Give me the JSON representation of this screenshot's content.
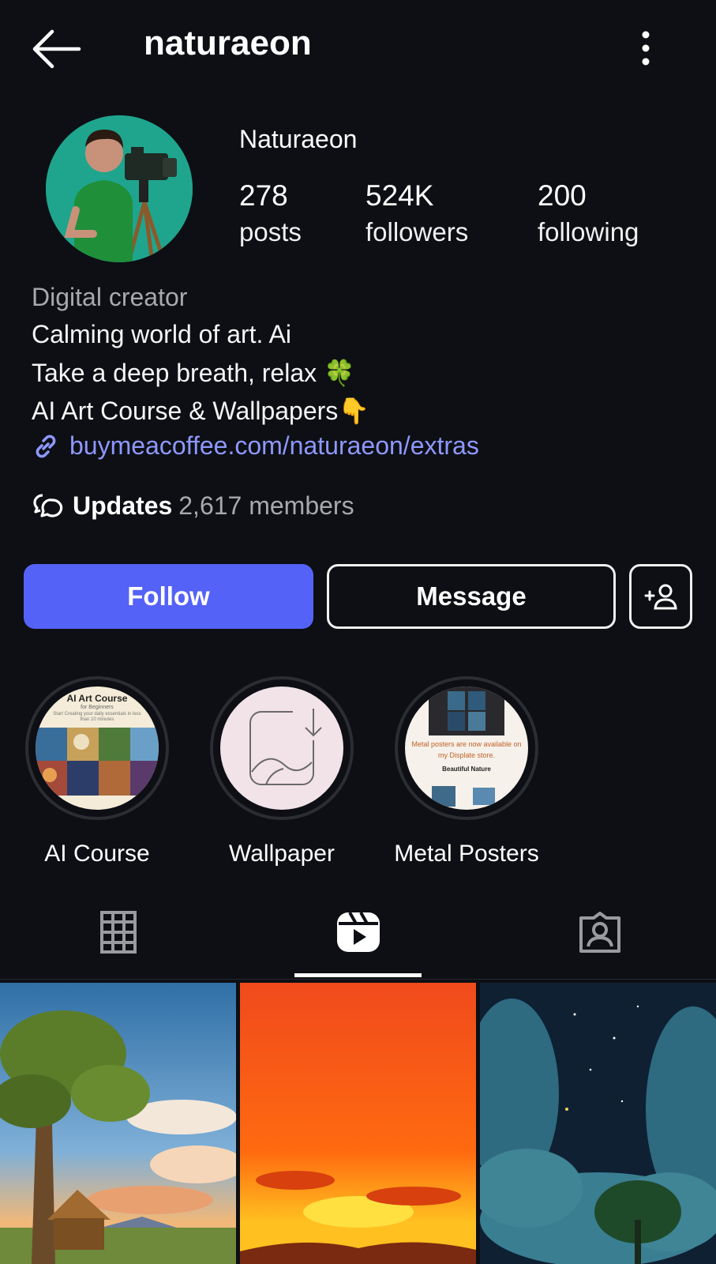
{
  "header": {
    "username": "naturaeon",
    "back_icon": "arrow-left-icon",
    "more_icon": "more-vertical-icon"
  },
  "profile": {
    "display_name": "Naturaeon",
    "stats": [
      {
        "value": "278",
        "label": "posts"
      },
      {
        "value": "524K",
        "label": "followers"
      },
      {
        "value": "200",
        "label": "following"
      }
    ]
  },
  "bio": {
    "category": "Digital creator",
    "line1": "Calming world of art. Ai",
    "line2": "Take a deep breath, relax 🍀",
    "line3": "AI Art Course & Wallpapers👇",
    "link": "buymeacoffee.com/naturaeon/extras"
  },
  "channel": {
    "name": "Updates",
    "members": "2,617 members"
  },
  "actions": {
    "follow_label": "Follow",
    "message_label": "Message"
  },
  "highlights": [
    {
      "label": "AI Course",
      "cover_title": "AI Art Course",
      "cover_sub": "for Beginners",
      "cover_text": "Start Creating your daily essentials in less than 10 minutes"
    },
    {
      "label": "Wallpaper"
    },
    {
      "label": "Metal Posters",
      "cover_text": "Metal posters are now available on my Displate store.",
      "cover_title": "Beautiful Nature"
    }
  ],
  "tabs": {
    "active": "reels",
    "items": [
      "grid-icon",
      "reels-icon",
      "tagged-icon"
    ]
  },
  "colors": {
    "background": "#0d0f14",
    "accent": "#5562f7",
    "link": "#8e98ff",
    "muted": "#a8a8ad"
  }
}
